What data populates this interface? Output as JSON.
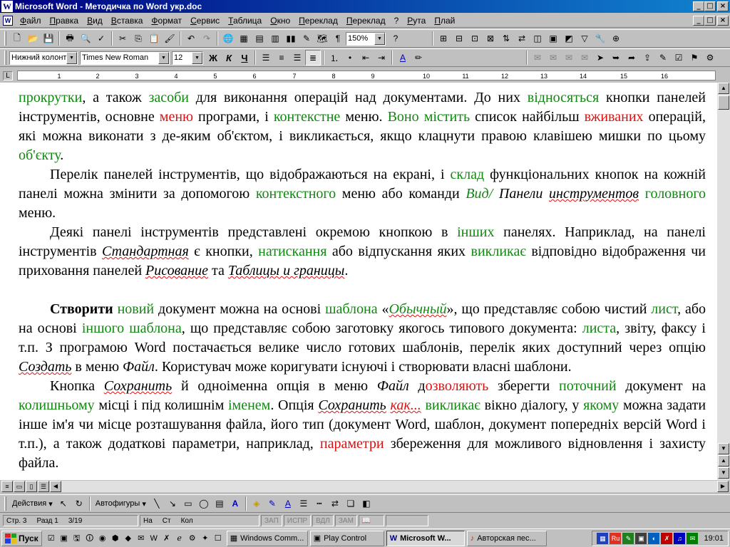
{
  "window": {
    "title": "Microsoft Word - Методичка по Word укр.doc",
    "controls": [
      "_",
      "□",
      "×"
    ]
  },
  "menubar": {
    "items": [
      "Файл",
      "Правка",
      "Вид",
      "Вставка",
      "Формат",
      "Сервис",
      "Таблица",
      "Окно",
      "Переклад",
      "Переклад",
      "?",
      "Рута",
      "Плай"
    ]
  },
  "toolbar_standard": {
    "zoom": "150%"
  },
  "toolbar_format": {
    "style": "Нижний колонти",
    "font": "Times New Roman",
    "size": "12",
    "bold": "Ж",
    "italic": "К",
    "underline": "Ч"
  },
  "ruler": {
    "ticks": [
      "1",
      "2",
      "3",
      "4",
      "5",
      "6",
      "7",
      "8",
      "9",
      "10",
      "11",
      "12",
      "13",
      "14",
      "15",
      "16"
    ]
  },
  "document": {
    "p1": [
      {
        "t": "прокрутки",
        "c": "g"
      },
      {
        "t": ", а також "
      },
      {
        "t": "засоби",
        "c": "g"
      },
      {
        "t": " для виконання операцій над документами. До них "
      },
      {
        "t": "відносяться",
        "c": "g"
      },
      {
        "t": " кнопки панелей інструментів, основне "
      },
      {
        "t": "меню",
        "c": "r"
      },
      {
        "t": " програми, і "
      },
      {
        "t": "контекстне",
        "c": "g"
      },
      {
        "t": " меню. "
      },
      {
        "t": "Воно містить",
        "c": "g"
      },
      {
        "t": " список найбільш "
      },
      {
        "t": "вживаних",
        "c": "r"
      },
      {
        "t": " операцій, які можна виконати з де-яким об'єктом, і викликається, якщо клацнути правою клавішею мишки по цьому "
      },
      {
        "t": "об'єкту",
        "c": "g"
      },
      {
        "t": "."
      }
    ],
    "p2": [
      {
        "t": "Перелік панелей інструментів, що відображаються на екрані, і "
      },
      {
        "t": "склад",
        "c": "g"
      },
      {
        "t": " функціональних кнопок на кожній панелі можна змінити за допомогою "
      },
      {
        "t": "контекстного",
        "c": "g"
      },
      {
        "t": " меню або команди "
      },
      {
        "t": "Вид/",
        "c": "g it"
      },
      {
        "t": " "
      },
      {
        "t": "Панели",
        "c": "it"
      },
      {
        "t": " "
      },
      {
        "t": "инструментов",
        "c": "it wavy"
      },
      {
        "t": " "
      },
      {
        "t": "головного",
        "c": "g"
      },
      {
        "t": " меню."
      }
    ],
    "p3": [
      {
        "t": "Деякі панелі інструментів представлені окремою кнопкою в "
      },
      {
        "t": "інших",
        "c": "g"
      },
      {
        "t": " панелях. Наприклад, на панелі інструментів "
      },
      {
        "t": "Стандартная",
        "c": "it wavy"
      },
      {
        "t": " є кнопки, "
      },
      {
        "t": "натискання",
        "c": "g"
      },
      {
        "t": " або відпускання яких "
      },
      {
        "t": "викликає",
        "c": "g"
      },
      {
        "t": " відповідно відображення чи приховання панелей "
      },
      {
        "t": "Рисование",
        "c": "it wavy"
      },
      {
        "t": " та "
      },
      {
        "t": "Таблицы и границы",
        "c": "it wavy"
      },
      {
        "t": "."
      }
    ],
    "p4": [
      {
        "t": "Створити",
        "c": "bd"
      },
      {
        "t": " "
      },
      {
        "t": "новий",
        "c": "g"
      },
      {
        "t": " документ можна на основі "
      },
      {
        "t": "шаблона",
        "c": "g"
      },
      {
        "t": " «"
      },
      {
        "t": "Обычный",
        "c": "g it wavy"
      },
      {
        "t": "», що представляє собою чистий "
      },
      {
        "t": "лист",
        "c": "g"
      },
      {
        "t": ", або на основі "
      },
      {
        "t": "іншого шаблона",
        "c": "g"
      },
      {
        "t": ", що представляє собою заготовку якогось типового документа: "
      },
      {
        "t": "листа",
        "c": "g"
      },
      {
        "t": ", звіту, факсу і т.п. З програмою Word постачається велике число готових шаблонів, перелік яких доступний через опцію "
      },
      {
        "t": "Создать",
        "c": "it wavy"
      },
      {
        "t": " в меню "
      },
      {
        "t": "Файл",
        "c": "it"
      },
      {
        "t": ". Користувач може коригувати існуючі і створювати власні шаблони."
      }
    ],
    "p5": [
      {
        "t": "Кнопка "
      },
      {
        "t": "Сохранить",
        "c": "it wavy"
      },
      {
        "t": " й одноіменна опція в меню "
      },
      {
        "t": "Файл",
        "c": "it"
      },
      {
        "t": " д"
      },
      {
        "t": "озволяють",
        "c": "r"
      },
      {
        "t": " зберегти "
      },
      {
        "t": "поточний",
        "c": "g"
      },
      {
        "t": " документ на "
      },
      {
        "t": "колишньому",
        "c": "g"
      },
      {
        "t": " місці і під колишнім "
      },
      {
        "t": "іменем",
        "c": "g"
      },
      {
        "t": ". Опція "
      },
      {
        "t": "Сохранить",
        "c": "it wavy"
      },
      {
        "t": " "
      },
      {
        "t": "как...",
        "c": "it r wavy"
      },
      {
        "t": " "
      },
      {
        "t": "викликає",
        "c": "g"
      },
      {
        "t": " вікно діалогу, у "
      },
      {
        "t": "якому",
        "c": "g"
      },
      {
        "t": " можна задати інше ім'я чи місце розташування файла, його тип (документ Word, шаблон, документ попередніх версій Word і т.п.), а також додаткові параметри, наприклад, "
      },
      {
        "t": "параметри",
        "c": "r"
      },
      {
        "t": " збереження для можливого відновлення і захисту файла."
      }
    ]
  },
  "drawbar": {
    "actions": "Действия",
    "autoshapes": "Автофигуры"
  },
  "statusbar": {
    "page": "Стр. 3",
    "section": "Разд 1",
    "pages": "3/19",
    "at": "На",
    "line": "Ст",
    "col": "Кол",
    "modes": [
      "ЗАП",
      "ИСПР",
      "ВДЛ",
      "ЗАМ"
    ]
  },
  "taskbar": {
    "start": "Пуск",
    "tasks": [
      "Windows Comm...",
      "Play Control",
      "Microsoft W...",
      "Авторская пес..."
    ],
    "clock": "19:01"
  },
  "colors": {
    "titlebar_start": "#000080",
    "titlebar_end": "#1084d0",
    "green_text": "#118811",
    "red_text": "#e01010",
    "chrome": "#c0c0c0"
  }
}
